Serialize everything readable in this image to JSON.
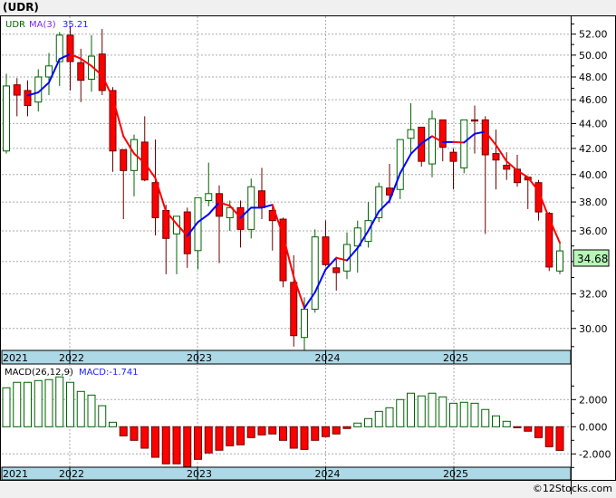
{
  "header": {
    "title": "(UDR)"
  },
  "footer": {
    "copyright": "©12Stocks.com"
  },
  "chart_data": [
    {
      "type": "candlestick",
      "symbol": "UDR",
      "legend": {
        "symbol": "UDR",
        "ma_label": "MA(3)",
        "ma_value": "35.21"
      },
      "last_price_label": "34.68",
      "y_scale": "log",
      "ylim": [
        28.8,
        53.8
      ],
      "grid": true,
      "y_ticks": [
        "52.00",
        "50.00",
        "48.00",
        "46.00",
        "44.00",
        "42.00",
        "40.00",
        "38.00",
        "36.00",
        "34.00",
        "32.00",
        "30.00"
      ],
      "x_tick_labels": [
        "2021",
        "2022",
        "2023",
        "2024",
        "2025"
      ],
      "dates": [
        "2021-07",
        "2021-08",
        "2021-09",
        "2021-10",
        "2021-11",
        "2021-12",
        "2022-01",
        "2022-02",
        "2022-03",
        "2022-04",
        "2022-05",
        "2022-06",
        "2022-07",
        "2022-08",
        "2022-09",
        "2022-10",
        "2022-11",
        "2022-12",
        "2023-01",
        "2023-02",
        "2023-03",
        "2023-04",
        "2023-05",
        "2023-06",
        "2023-07",
        "2023-08",
        "2023-09",
        "2023-10",
        "2023-11",
        "2023-12",
        "2024-01",
        "2024-02",
        "2024-03",
        "2024-04",
        "2024-05",
        "2024-06",
        "2024-07",
        "2024-08",
        "2024-09",
        "2024-10",
        "2024-11",
        "2024-12",
        "2025-01",
        "2025-02",
        "2025-03",
        "2025-04",
        "2025-05",
        "2025-06",
        "2025-07",
        "2025-08",
        "2025-09",
        "2025-10",
        "2025-11"
      ],
      "open": [
        41.8,
        47.3,
        46.8,
        45.8,
        48.0,
        49.4,
        51.9,
        49.3,
        47.8,
        50.1,
        46.8,
        41.9,
        40.3,
        42.5,
        39.4,
        37.4,
        35.8,
        37.3,
        34.7,
        38.1,
        38.6,
        36.9,
        37.6,
        36.1,
        38.8,
        37.4,
        36.8,
        32.7,
        29.5,
        31.1,
        35.6,
        33.6,
        33.4,
        35.0,
        35.3,
        36.9,
        39.0,
        38.9,
        42.8,
        43.7,
        40.8,
        44.3,
        41.7,
        40.5,
        44.3,
        44.3,
        41.6,
        40.7,
        40.4,
        39.8,
        39.4,
        37.2,
        33.4
      ],
      "high": [
        48.3,
        47.9,
        47.7,
        48.7,
        50.2,
        52.2,
        52.8,
        50.6,
        51.9,
        52.5,
        47.1,
        41.9,
        43.1,
        44.6,
        42.7,
        37.8,
        37.0,
        37.6,
        38.3,
        40.9,
        39.2,
        38.1,
        38.1,
        39.7,
        40.5,
        37.8,
        36.9,
        34.4,
        31.8,
        36.1,
        36.7,
        34.3,
        35.9,
        36.7,
        38.0,
        39.4,
        40.8,
        42.7,
        45.7,
        43.7,
        45.1,
        44.3,
        42.0,
        44.3,
        45.5,
        44.6,
        43.5,
        41.7,
        41.5,
        39.8,
        39.6,
        37.3,
        35.2
      ],
      "low": [
        41.6,
        44.6,
        44.6,
        45.0,
        46.4,
        47.2,
        46.8,
        45.8,
        46.7,
        46.4,
        40.2,
        36.8,
        38.4,
        39.5,
        35.7,
        33.2,
        33.2,
        33.6,
        33.5,
        37.7,
        33.9,
        36.0,
        34.9,
        35.5,
        36.8,
        34.7,
        32.4,
        29.0,
        28.5,
        30.9,
        33.7,
        32.2,
        32.9,
        33.3,
        34.9,
        36.6,
        37.9,
        38.2,
        41.6,
        40.6,
        39.8,
        41.0,
        38.9,
        40.1,
        41.6,
        35.8,
        38.9,
        39.6,
        39.1,
        37.5,
        36.7,
        33.4,
        33.2
      ],
      "close": [
        47.2,
        46.4,
        45.5,
        48.0,
        49.0,
        51.9,
        49.4,
        47.7,
        49.9,
        46.8,
        41.8,
        40.3,
        42.7,
        39.6,
        36.9,
        35.5,
        37.0,
        34.5,
        38.3,
        38.6,
        37.0,
        37.6,
        36.1,
        39.1,
        37.6,
        36.7,
        32.8,
        29.6,
        31.1,
        35.6,
        33.8,
        33.3,
        35.1,
        36.2,
        36.7,
        39.1,
        38.5,
        42.7,
        43.5,
        41.0,
        44.4,
        42.1,
        41.0,
        44.3,
        44.2,
        41.5,
        41.1,
        40.4,
        39.4,
        39.6,
        37.3,
        33.65,
        34.68
      ],
      "colors": {
        "up": "#006400",
        "down": "#ff0000",
        "down_outline": "#6b0000",
        "ma_up": "#0000ff",
        "ma_down": "#ff0000",
        "date_strip": "#add8e6",
        "price_tag": "#b8f5b8"
      }
    },
    {
      "type": "bar",
      "legend": {
        "label": "MACD(26,12,9)",
        "value_label": "MACD:-1.741"
      },
      "ylim": [
        -3.0,
        4.0
      ],
      "grid": true,
      "y_ticks": [
        "2.000",
        "0.000",
        "-2.000"
      ],
      "y_tick_values": [
        2,
        0,
        -2
      ],
      "x_tick_labels": [
        "2021",
        "2022",
        "2023",
        "2024",
        "2025"
      ],
      "values": [
        2.87,
        3.27,
        3.27,
        3.4,
        3.47,
        3.67,
        3.27,
        2.6,
        2.33,
        1.55,
        0.33,
        -0.67,
        -1.0,
        -1.58,
        -2.25,
        -2.73,
        -2.73,
        -2.95,
        -2.4,
        -1.93,
        -1.73,
        -1.4,
        -1.33,
        -0.8,
        -0.6,
        -0.53,
        -1.0,
        -1.58,
        -1.67,
        -1.0,
        -0.73,
        -0.53,
        -0.13,
        0.27,
        0.6,
        1.13,
        1.4,
        2.0,
        2.47,
        2.27,
        2.47,
        2.2,
        1.73,
        1.8,
        1.73,
        1.27,
        0.8,
        0.4,
        -0.07,
        -0.33,
        -0.8,
        -1.47,
        -1.741
      ],
      "colors": {
        "positive": "#006400",
        "negative": "#ff0000"
      }
    }
  ]
}
